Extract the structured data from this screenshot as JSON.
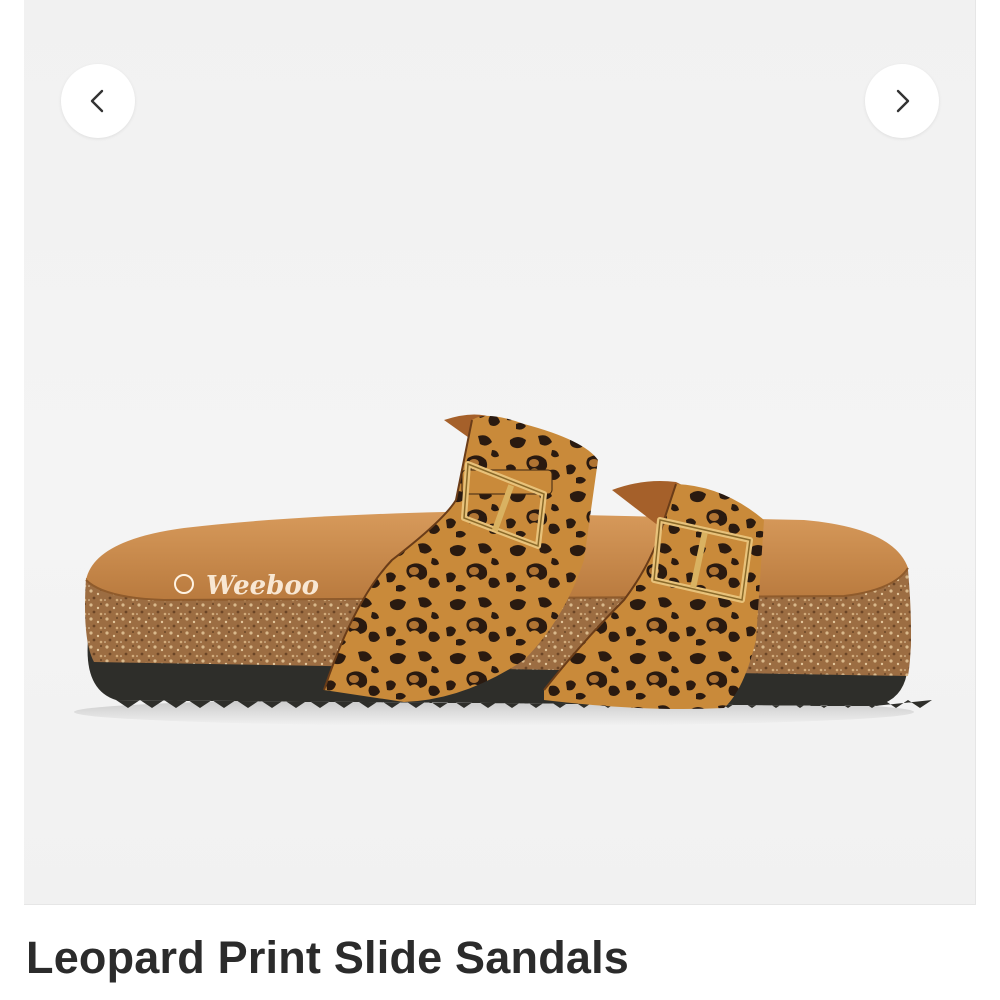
{
  "gallery": {
    "prev_icon": "chevron-left-icon",
    "next_icon": "chevron-right-icon",
    "image_alt": "leopard print slide sandal, side view",
    "sole_brand_text": "Weeboo"
  },
  "product": {
    "title": "Leopard Print Slide Sandals"
  },
  "colors": {
    "background": "#f2f2f2",
    "title_text": "#2b2b2b",
    "leopard_base": "#c98a3a",
    "leopard_spots": "#2a1a10",
    "footbed": "#c8894a",
    "cork": "#a8784a",
    "outsole": "#2e2e2a"
  }
}
